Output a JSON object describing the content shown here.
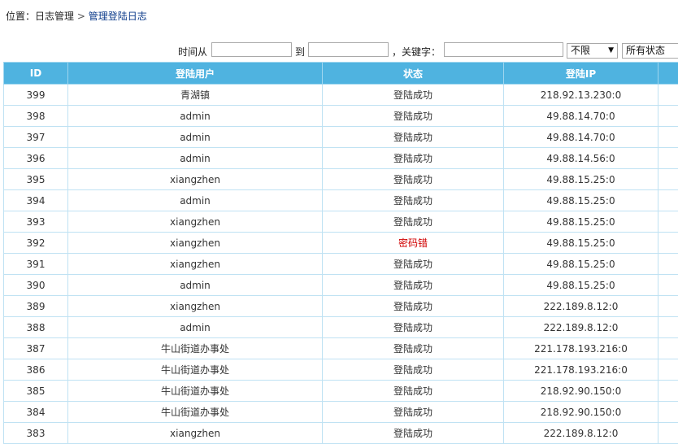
{
  "breadcrumb": {
    "prefix": "位置：",
    "parent": "日志管理",
    "separator": " > ",
    "current": "管理登陆日志"
  },
  "filter": {
    "time_from_label": "时间从",
    "time_to_label": "到",
    "keyword_label": "，关键字：",
    "time_from_value": "",
    "time_to_value": "",
    "keyword_value": "",
    "type_select": "不限",
    "status_select": "所有状态"
  },
  "table": {
    "columns": [
      "ID",
      "登陆用户",
      "状态",
      "登陆IP",
      ""
    ],
    "rows": [
      {
        "id": "399",
        "user": "青湖镇",
        "status": "登陆成功",
        "ip": "218.92.13.230:0"
      },
      {
        "id": "398",
        "user": "admin",
        "status": "登陆成功",
        "ip": "49.88.14.70:0"
      },
      {
        "id": "397",
        "user": "admin",
        "status": "登陆成功",
        "ip": "49.88.14.70:0"
      },
      {
        "id": "396",
        "user": "admin",
        "status": "登陆成功",
        "ip": "49.88.14.56:0"
      },
      {
        "id": "395",
        "user": "xiangzhen",
        "status": "登陆成功",
        "ip": "49.88.15.25:0"
      },
      {
        "id": "394",
        "user": "admin",
        "status": "登陆成功",
        "ip": "49.88.15.25:0"
      },
      {
        "id": "393",
        "user": "xiangzhen",
        "status": "登陆成功",
        "ip": "49.88.15.25:0"
      },
      {
        "id": "392",
        "user": "xiangzhen",
        "status": "密码错",
        "ip": "49.88.15.25:0",
        "error": true
      },
      {
        "id": "391",
        "user": "xiangzhen",
        "status": "登陆成功",
        "ip": "49.88.15.25:0"
      },
      {
        "id": "390",
        "user": "admin",
        "status": "登陆成功",
        "ip": "49.88.15.25:0"
      },
      {
        "id": "389",
        "user": "xiangzhen",
        "status": "登陆成功",
        "ip": "222.189.8.12:0"
      },
      {
        "id": "388",
        "user": "admin",
        "status": "登陆成功",
        "ip": "222.189.8.12:0"
      },
      {
        "id": "387",
        "user": "牛山街道办事处",
        "status": "登陆成功",
        "ip": "221.178.193.216:0"
      },
      {
        "id": "386",
        "user": "牛山街道办事处",
        "status": "登陆成功",
        "ip": "221.178.193.216:0"
      },
      {
        "id": "385",
        "user": "牛山街道办事处",
        "status": "登陆成功",
        "ip": "218.92.90.150:0"
      },
      {
        "id": "384",
        "user": "牛山街道办事处",
        "status": "登陆成功",
        "ip": "218.92.90.150:0"
      },
      {
        "id": "383",
        "user": "xiangzhen",
        "status": "登陆成功",
        "ip": "222.189.8.12:0"
      }
    ]
  },
  "colors": {
    "header_bg": "#4fb3e0",
    "border": "#bfe2f3",
    "error_text": "#d00000",
    "link": "#0b3a8a"
  }
}
